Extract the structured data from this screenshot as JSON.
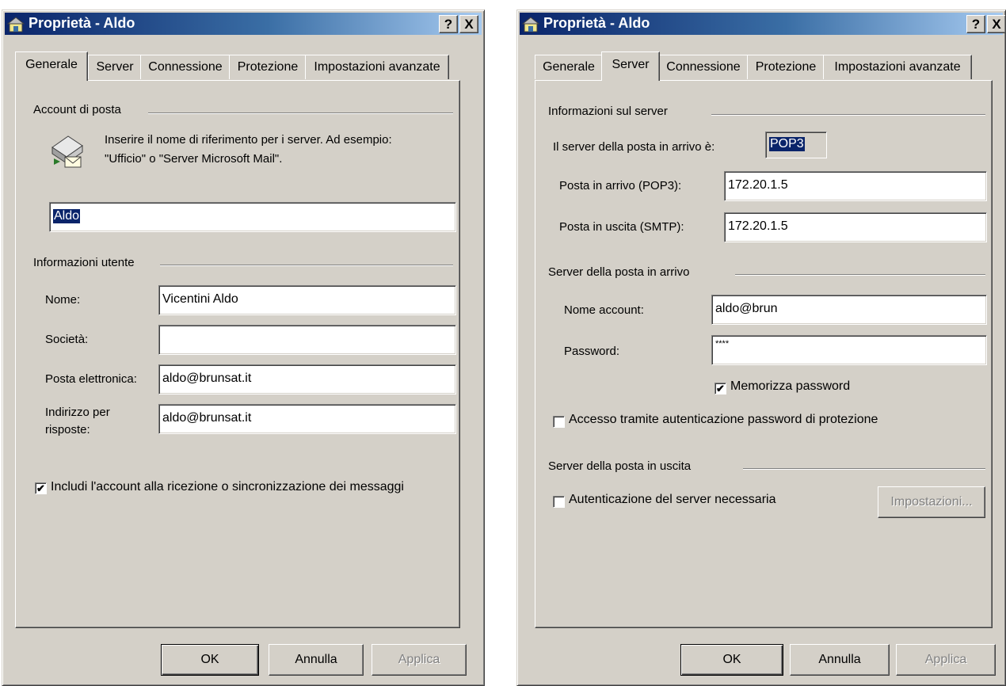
{
  "window1": {
    "title": "Proprietà - Aldo",
    "help_label": "?",
    "close_label": "X",
    "tabs": [
      "Generale",
      "Server",
      "Connessione",
      "Protezione",
      "Impostazioni avanzate"
    ],
    "account_group": "Account di posta",
    "account_desc_1": "Inserire il nome di riferimento per i server. Ad esempio:",
    "account_desc_2": "\"Ufficio\" o \"Server Microsoft Mail\".",
    "account_name": "Aldo",
    "user_group": "Informazioni utente",
    "nome_label": "Nome:",
    "nome_value": "Vicentini Aldo",
    "societa_label": "Società:",
    "societa_value": "",
    "email_label": "Posta elettronica:",
    "email_value": "aldo@brunsat.it",
    "reply_label_1": "Indirizzo per",
    "reply_label_2": "risposte:",
    "reply_value": "aldo@brunsat.it",
    "include_label": "Includi l'account alla ricezione o sincronizzazione dei messaggi",
    "include_checked": true,
    "ok_label": "OK",
    "cancel_label": "Annulla",
    "apply_label": "Applica"
  },
  "window2": {
    "title": "Proprietà - Aldo",
    "help_label": "?",
    "close_label": "X",
    "tabs": [
      "Generale",
      "Server",
      "Connessione",
      "Protezione",
      "Impostazioni avanzate"
    ],
    "server_group": "Informazioni sul server",
    "incoming_type_label": "Il server della posta in arrivo è:",
    "incoming_type_value": "POP3",
    "pop3_label": "Posta in arrivo (POP3):",
    "pop3_value": "172.20.1.5",
    "smtp_label": "Posta in uscita (SMTP):",
    "smtp_value": "172.20.1.5",
    "incoming_group": "Server della posta in arrivo",
    "account_label": "Nome account:",
    "account_value": "aldo@brun",
    "password_label": "Password:",
    "password_value": "****",
    "remember_label": "Memorizza password",
    "remember_checked": true,
    "spa_label": "Accesso tramite autenticazione password di protezione",
    "spa_checked": false,
    "outgoing_group": "Server della posta in uscita",
    "auth_label": "Autenticazione del server necessaria",
    "auth_checked": false,
    "settings_label": "Impostazioni...",
    "ok_label": "OK",
    "cancel_label": "Annulla",
    "apply_label": "Applica"
  }
}
